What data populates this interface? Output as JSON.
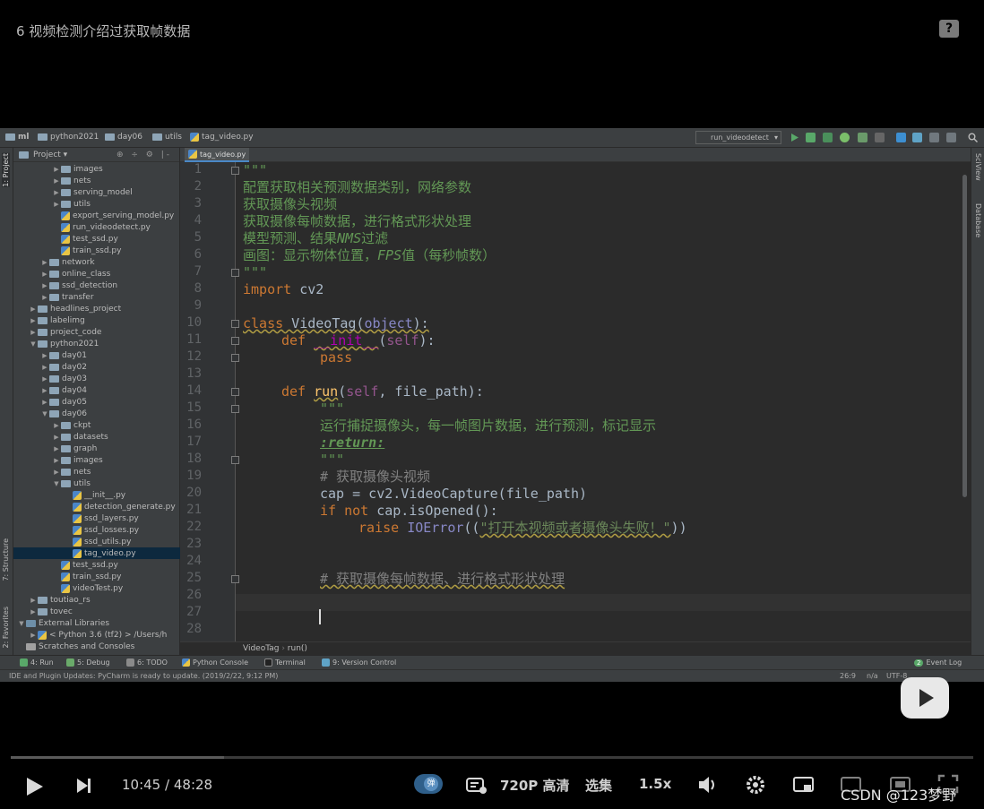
{
  "video": {
    "title": "6 视频检测介绍过获取帧数据",
    "current_time": "10:45",
    "separator": "/",
    "total_time": "48:28",
    "progress_fraction": 0.222,
    "danmu_label": "弹",
    "quality_label": "720P 高清",
    "episodes_label": "选集",
    "speed_label": "1.5x",
    "watermark": "CSDN @123梦野"
  },
  "navbar": {
    "crumbs": [
      "ml",
      "python2021",
      "day06",
      "utils",
      "tag_video.py"
    ],
    "run_config": "run_videodetect"
  },
  "left_strip": {
    "project": "1: Project",
    "structure": "7: Structure",
    "favorites": "2: Favorites"
  },
  "right_strip": {
    "sciview": "SciView",
    "database": "Database"
  },
  "project_panel": {
    "header": "Project",
    "tree": [
      {
        "label": "images",
        "depth": 3,
        "type": "folder",
        "arrow": "▶"
      },
      {
        "label": "nets",
        "depth": 3,
        "type": "folder",
        "arrow": "▶"
      },
      {
        "label": "serving_model",
        "depth": 3,
        "type": "folder",
        "arrow": "▶"
      },
      {
        "label": "utils",
        "depth": 3,
        "type": "folder",
        "arrow": "▶"
      },
      {
        "label": "export_serving_model.py",
        "depth": 3,
        "type": "py",
        "arrow": ""
      },
      {
        "label": "run_videodetect.py",
        "depth": 3,
        "type": "py",
        "arrow": ""
      },
      {
        "label": "test_ssd.py",
        "depth": 3,
        "type": "py",
        "arrow": ""
      },
      {
        "label": "train_ssd.py",
        "depth": 3,
        "type": "py",
        "arrow": ""
      },
      {
        "label": "network",
        "depth": 2,
        "type": "folder",
        "arrow": "▶"
      },
      {
        "label": "online_class",
        "depth": 2,
        "type": "folder",
        "arrow": "▶"
      },
      {
        "label": "ssd_detection",
        "depth": 2,
        "type": "folder",
        "arrow": "▶"
      },
      {
        "label": "transfer",
        "depth": 2,
        "type": "folder",
        "arrow": "▶"
      },
      {
        "label": "headlines_project",
        "depth": 1,
        "type": "folder",
        "arrow": "▶"
      },
      {
        "label": "labelimg",
        "depth": 1,
        "type": "folder",
        "arrow": "▶"
      },
      {
        "label": "project_code",
        "depth": 1,
        "type": "folder",
        "arrow": "▶"
      },
      {
        "label": "python2021",
        "depth": 1,
        "type": "folder",
        "arrow": "▼"
      },
      {
        "label": "day01",
        "depth": 2,
        "type": "folder",
        "arrow": "▶"
      },
      {
        "label": "day02",
        "depth": 2,
        "type": "folder",
        "arrow": "▶"
      },
      {
        "label": "day03",
        "depth": 2,
        "type": "folder",
        "arrow": "▶"
      },
      {
        "label": "day04",
        "depth": 2,
        "type": "folder",
        "arrow": "▶"
      },
      {
        "label": "day05",
        "depth": 2,
        "type": "folder",
        "arrow": "▶"
      },
      {
        "label": "day06",
        "depth": 2,
        "type": "folder",
        "arrow": "▼"
      },
      {
        "label": "ckpt",
        "depth": 3,
        "type": "folder",
        "arrow": "▶"
      },
      {
        "label": "datasets",
        "depth": 3,
        "type": "folder",
        "arrow": "▶"
      },
      {
        "label": "graph",
        "depth": 3,
        "type": "folder",
        "arrow": "▶"
      },
      {
        "label": "images",
        "depth": 3,
        "type": "folder",
        "arrow": "▶"
      },
      {
        "label": "nets",
        "depth": 3,
        "type": "folder",
        "arrow": "▶"
      },
      {
        "label": "utils",
        "depth": 3,
        "type": "folder",
        "arrow": "▼"
      },
      {
        "label": "__init__.py",
        "depth": 4,
        "type": "py",
        "arrow": ""
      },
      {
        "label": "detection_generate.py",
        "depth": 4,
        "type": "py",
        "arrow": ""
      },
      {
        "label": "ssd_layers.py",
        "depth": 4,
        "type": "py",
        "arrow": ""
      },
      {
        "label": "ssd_losses.py",
        "depth": 4,
        "type": "py",
        "arrow": ""
      },
      {
        "label": "ssd_utils.py",
        "depth": 4,
        "type": "py",
        "arrow": ""
      },
      {
        "label": "tag_video.py",
        "depth": 4,
        "type": "py",
        "arrow": "",
        "selected": true
      },
      {
        "label": "test_ssd.py",
        "depth": 3,
        "type": "py",
        "arrow": ""
      },
      {
        "label": "train_ssd.py",
        "depth": 3,
        "type": "py",
        "arrow": ""
      },
      {
        "label": "videoTest.py",
        "depth": 3,
        "type": "py",
        "arrow": ""
      },
      {
        "label": "toutiao_rs",
        "depth": 1,
        "type": "folder",
        "arrow": "▶"
      },
      {
        "label": "tovec",
        "depth": 1,
        "type": "folder",
        "arrow": "▶"
      },
      {
        "label": "External Libraries",
        "depth": 0,
        "type": "lib",
        "arrow": "▼"
      },
      {
        "label": "< Python 3.6 (tf2) > /Users/h",
        "depth": 1,
        "type": "py",
        "arrow": "▶"
      },
      {
        "label": "Scratches and Consoles",
        "depth": 0,
        "type": "scr",
        "arrow": ""
      }
    ]
  },
  "editor": {
    "tab_label": "tag_video.py",
    "breadcrumb": [
      "VideoTag",
      "run()"
    ],
    "line_numbers": [
      "1",
      "2",
      "3",
      "4",
      "5",
      "6",
      "7",
      "8",
      "9",
      "10",
      "11",
      "12",
      "13",
      "14",
      "15",
      "16",
      "17",
      "18",
      "19",
      "20",
      "21",
      "22",
      "23",
      "24",
      "25",
      "26",
      "27",
      "28"
    ],
    "lines": {
      "l1": "\"\"\"",
      "l2": "配置获取相关预测数据类别，网络参数",
      "l3": "获取摄像头视频",
      "l4": "获取摄像每帧数据，进行格式形状处理",
      "l5a": "模型预测、结果",
      "l5b": "NMS",
      "l5c": "过滤",
      "l6a": "画图：显示物体位置，",
      "l6b": "FPS",
      "l6c": "值（每秒帧数）",
      "l7": "\"\"\"",
      "l8a": "import",
      "l8b": " cv2",
      "l10a": "class",
      "l10b": " VideoTag(",
      "l10c": "object",
      "l10d": "):",
      "l11a": "def",
      "l11b": "__init__",
      "l11c": "(",
      "l11d": "self",
      "l11e": "):",
      "l12": "pass",
      "l14a": "def",
      "l14b": "run",
      "l14c": "(",
      "l14d": "self",
      "l14e": ", file_path):",
      "l15": "\"\"\"",
      "l16": "运行捕捉摄像头，每一帧图片数据，进行预测，标记显示",
      "l17": ":return:",
      "l18": "\"\"\"",
      "l19": "# 获取摄像头视频",
      "l20": "cap = cv2.VideoCapture(file_path)",
      "l21a": "if not",
      "l21b": " cap.isOpened():",
      "l22a": "raise",
      "l22b": "IOError",
      "l22c": "((",
      "l22d": "\"打开本视频或者摄像头失败！\"",
      "l22e": "))",
      "l25": "# 获取摄像每帧数据、进行格式形状处理"
    }
  },
  "tool_windows": [
    "4: Run",
    "5: Debug",
    "6: TODO",
    "Python Console",
    "Terminal",
    "9: Version Control"
  ],
  "event_log": {
    "count": "2",
    "label": "Event Log"
  },
  "status": {
    "message": "IDE and Plugin Updates: PyCharm is ready to update. (2019/2/22, 9:12 PM)",
    "position": "26:9",
    "lf": "n/a",
    "encoding": "UTF-8"
  },
  "colors": {
    "keyword": "#cc7832",
    "docstring": "#629755",
    "comment": "#808080",
    "function": "#ffc66d",
    "self": "#94558d",
    "ide_bg": "#2b2b2b",
    "panel_bg": "#3c3f41"
  }
}
